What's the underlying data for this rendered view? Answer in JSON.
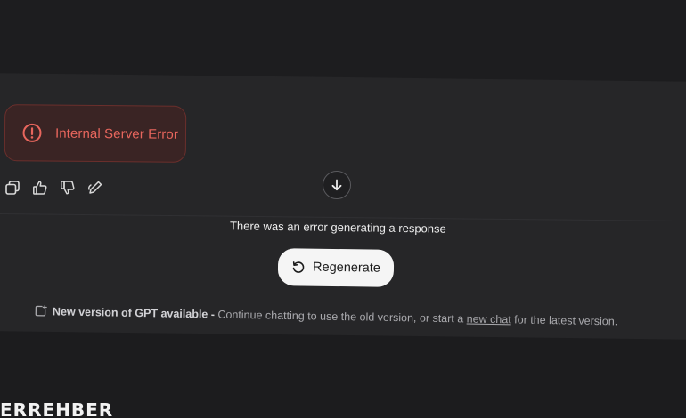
{
  "error": {
    "message": "Internal Server Error",
    "icon": "info-circle-icon",
    "color": "#e8665d"
  },
  "actions": {
    "icons": [
      "copy-icon",
      "thumbs-up-icon",
      "thumbs-down-icon",
      "edit-icon"
    ]
  },
  "scroll_down_icon": "arrow-down-icon",
  "status_message": "There was an error generating a response",
  "regenerate": {
    "label": "Regenerate",
    "icon": "refresh-icon"
  },
  "notice": {
    "icon": "new-chat-icon",
    "headline": "New version of GPT available",
    "separator": " - ",
    "text_before_link": "Continue chatting to use the old version, or start a ",
    "link_text": "new chat",
    "text_after_link": " for the latest version."
  },
  "watermark": {
    "text": "ERREHBER",
    "accent_color": "#e63a2e"
  },
  "colors": {
    "background": "#1c1c1e",
    "panel": "#262628",
    "button_bg": "#f5f5f5"
  }
}
